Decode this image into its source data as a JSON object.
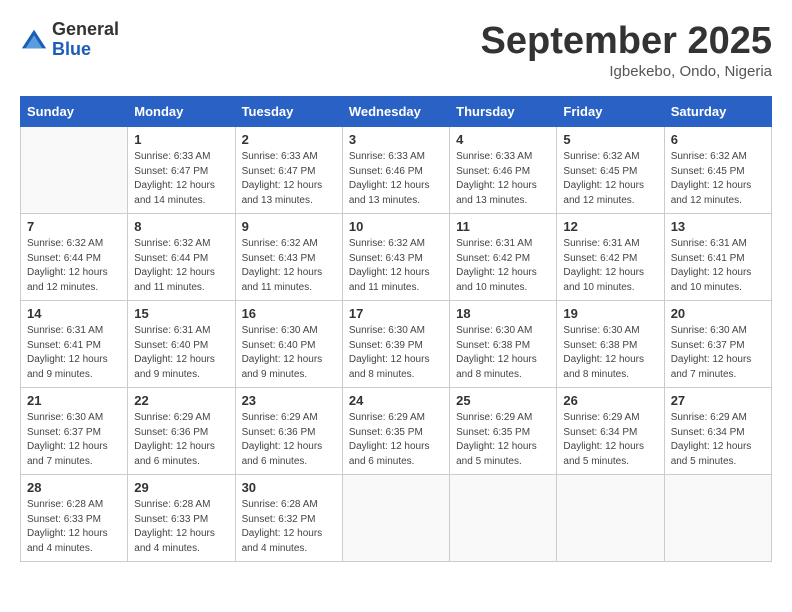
{
  "logo": {
    "general": "General",
    "blue": "Blue"
  },
  "title": "September 2025",
  "location": "Igbekebo, Ondo, Nigeria",
  "weekdays": [
    "Sunday",
    "Monday",
    "Tuesday",
    "Wednesday",
    "Thursday",
    "Friday",
    "Saturday"
  ],
  "weeks": [
    [
      {
        "day": null
      },
      {
        "day": 1,
        "sunrise": "6:33 AM",
        "sunset": "6:47 PM",
        "daylight": "12 hours and 14 minutes."
      },
      {
        "day": 2,
        "sunrise": "6:33 AM",
        "sunset": "6:47 PM",
        "daylight": "12 hours and 13 minutes."
      },
      {
        "day": 3,
        "sunrise": "6:33 AM",
        "sunset": "6:46 PM",
        "daylight": "12 hours and 13 minutes."
      },
      {
        "day": 4,
        "sunrise": "6:33 AM",
        "sunset": "6:46 PM",
        "daylight": "12 hours and 13 minutes."
      },
      {
        "day": 5,
        "sunrise": "6:32 AM",
        "sunset": "6:45 PM",
        "daylight": "12 hours and 12 minutes."
      },
      {
        "day": 6,
        "sunrise": "6:32 AM",
        "sunset": "6:45 PM",
        "daylight": "12 hours and 12 minutes."
      }
    ],
    [
      {
        "day": 7,
        "sunrise": "6:32 AM",
        "sunset": "6:44 PM",
        "daylight": "12 hours and 12 minutes."
      },
      {
        "day": 8,
        "sunrise": "6:32 AM",
        "sunset": "6:44 PM",
        "daylight": "12 hours and 11 minutes."
      },
      {
        "day": 9,
        "sunrise": "6:32 AM",
        "sunset": "6:43 PM",
        "daylight": "12 hours and 11 minutes."
      },
      {
        "day": 10,
        "sunrise": "6:32 AM",
        "sunset": "6:43 PM",
        "daylight": "12 hours and 11 minutes."
      },
      {
        "day": 11,
        "sunrise": "6:31 AM",
        "sunset": "6:42 PM",
        "daylight": "12 hours and 10 minutes."
      },
      {
        "day": 12,
        "sunrise": "6:31 AM",
        "sunset": "6:42 PM",
        "daylight": "12 hours and 10 minutes."
      },
      {
        "day": 13,
        "sunrise": "6:31 AM",
        "sunset": "6:41 PM",
        "daylight": "12 hours and 10 minutes."
      }
    ],
    [
      {
        "day": 14,
        "sunrise": "6:31 AM",
        "sunset": "6:41 PM",
        "daylight": "12 hours and 9 minutes."
      },
      {
        "day": 15,
        "sunrise": "6:31 AM",
        "sunset": "6:40 PM",
        "daylight": "12 hours and 9 minutes."
      },
      {
        "day": 16,
        "sunrise": "6:30 AM",
        "sunset": "6:40 PM",
        "daylight": "12 hours and 9 minutes."
      },
      {
        "day": 17,
        "sunrise": "6:30 AM",
        "sunset": "6:39 PM",
        "daylight": "12 hours and 8 minutes."
      },
      {
        "day": 18,
        "sunrise": "6:30 AM",
        "sunset": "6:38 PM",
        "daylight": "12 hours and 8 minutes."
      },
      {
        "day": 19,
        "sunrise": "6:30 AM",
        "sunset": "6:38 PM",
        "daylight": "12 hours and 8 minutes."
      },
      {
        "day": 20,
        "sunrise": "6:30 AM",
        "sunset": "6:37 PM",
        "daylight": "12 hours and 7 minutes."
      }
    ],
    [
      {
        "day": 21,
        "sunrise": "6:30 AM",
        "sunset": "6:37 PM",
        "daylight": "12 hours and 7 minutes."
      },
      {
        "day": 22,
        "sunrise": "6:29 AM",
        "sunset": "6:36 PM",
        "daylight": "12 hours and 6 minutes."
      },
      {
        "day": 23,
        "sunrise": "6:29 AM",
        "sunset": "6:36 PM",
        "daylight": "12 hours and 6 minutes."
      },
      {
        "day": 24,
        "sunrise": "6:29 AM",
        "sunset": "6:35 PM",
        "daylight": "12 hours and 6 minutes."
      },
      {
        "day": 25,
        "sunrise": "6:29 AM",
        "sunset": "6:35 PM",
        "daylight": "12 hours and 5 minutes."
      },
      {
        "day": 26,
        "sunrise": "6:29 AM",
        "sunset": "6:34 PM",
        "daylight": "12 hours and 5 minutes."
      },
      {
        "day": 27,
        "sunrise": "6:29 AM",
        "sunset": "6:34 PM",
        "daylight": "12 hours and 5 minutes."
      }
    ],
    [
      {
        "day": 28,
        "sunrise": "6:28 AM",
        "sunset": "6:33 PM",
        "daylight": "12 hours and 4 minutes."
      },
      {
        "day": 29,
        "sunrise": "6:28 AM",
        "sunset": "6:33 PM",
        "daylight": "12 hours and 4 minutes."
      },
      {
        "day": 30,
        "sunrise": "6:28 AM",
        "sunset": "6:32 PM",
        "daylight": "12 hours and 4 minutes."
      },
      {
        "day": null
      },
      {
        "day": null
      },
      {
        "day": null
      },
      {
        "day": null
      }
    ]
  ]
}
